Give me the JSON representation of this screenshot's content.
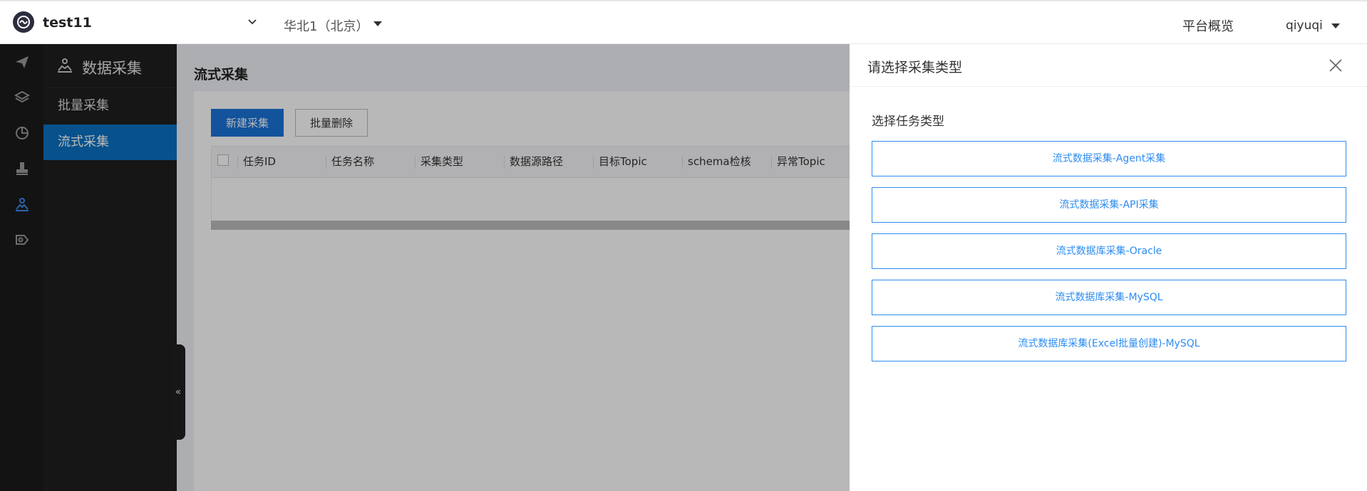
{
  "header": {
    "project": "test11",
    "region": "华北1（北京）",
    "platform_overview": "平台概览",
    "username": "qiyuqi"
  },
  "rail": {
    "icons": [
      "paper-plane-icon",
      "layers-icon",
      "pie-chart-icon",
      "stamp-icon",
      "data-collect-icon",
      "share-icon"
    ]
  },
  "subnav": {
    "title": "数据采集",
    "items": [
      {
        "label": "批量采集",
        "active": false
      },
      {
        "label": "流式采集",
        "active": true
      }
    ]
  },
  "main": {
    "page_title": "流式采集",
    "new_button": "新建采集",
    "batch_delete_button": "批量删除",
    "columns": [
      "任务ID",
      "任务名称",
      "采集类型",
      "数据源路径",
      "目标Topic",
      "schema检核",
      "异常Topic"
    ]
  },
  "drawer": {
    "title": "请选择采集类型",
    "subtitle": "选择任务类型",
    "options": [
      "流式数据采集-Agent采集",
      "流式数据采集-API采集",
      "流式数据库采集-Oracle",
      "流式数据库采集-MySQL",
      "流式数据库采集(Excel批量创建)-MySQL"
    ]
  },
  "colors": {
    "primary": "#1a73d9",
    "active_nav": "#0a72c2",
    "option_border": "#2d8cf0",
    "sidebar_bg": "#1f1f1f",
    "rail_bg": "#1b1b1b"
  }
}
